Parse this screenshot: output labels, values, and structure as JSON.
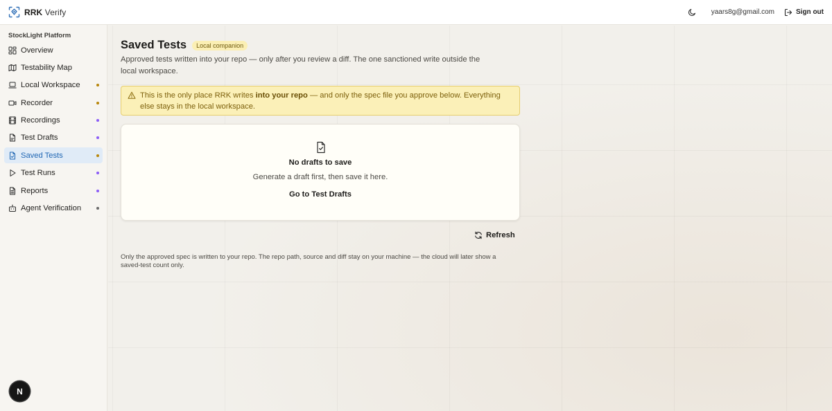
{
  "app": {
    "brand_strong": "RRK",
    "brand_light": "Verify",
    "logo_icon": "scan-shield-icon",
    "accent_color": "#1f66b3"
  },
  "header": {
    "theme_icon": "moon-icon",
    "user_email": "yaars8g@gmail.com",
    "signout_label": "Sign out",
    "signout_icon": "logout-icon"
  },
  "sidebar": {
    "heading": "StockLight Platform",
    "items": [
      {
        "label": "Overview",
        "icon": "dashboard-grid-icon",
        "dot": null,
        "active": false
      },
      {
        "label": "Testability Map",
        "icon": "map-icon",
        "dot": null,
        "active": false
      },
      {
        "label": "Local Workspace",
        "icon": "laptop-icon",
        "dot": "#b8860b",
        "active": false
      },
      {
        "label": "Recorder",
        "icon": "video-icon",
        "dot": "#b8860b",
        "active": false
      },
      {
        "label": "Recordings",
        "icon": "film-icon",
        "dot": "#8b5cf6",
        "active": false
      },
      {
        "label": "Test Drafts",
        "icon": "file-draft-icon",
        "dot": "#8b5cf6",
        "active": false
      },
      {
        "label": "Saved Tests",
        "icon": "file-check-icon",
        "dot": "#b8860b",
        "active": true
      },
      {
        "label": "Test Runs",
        "icon": "play-icon",
        "dot": "#8b5cf6",
        "active": false
      },
      {
        "label": "Reports",
        "icon": "report-icon",
        "dot": "#8b5cf6",
        "active": false
      },
      {
        "label": "Agent Verification",
        "icon": "robot-icon",
        "dot": "#6b6b6b",
        "active": false
      }
    ]
  },
  "main": {
    "title": "Saved Tests",
    "badge": "Local companion",
    "description": "Approved tests written into your repo — only after you review a diff. The one sanctioned write outside the local workspace.",
    "alert": {
      "icon": "warning-triangle-icon",
      "before": "This is the only place RRK writes ",
      "bold": "into your repo",
      "after": " — and only the spec file you approve below. Everything else stays in the local workspace."
    },
    "empty": {
      "icon": "file-check-icon",
      "title": "No drafts to save",
      "subtitle": "Generate a draft first, then save it here.",
      "action": "Go to Test Drafts"
    },
    "refresh_label": "Refresh",
    "refresh_icon": "refresh-icon",
    "footnote": "Only the approved spec is written to your repo. The repo path, source and diff stay on your machine — the cloud will later show a saved-test count only."
  },
  "overlay": {
    "next_badge": "N"
  }
}
